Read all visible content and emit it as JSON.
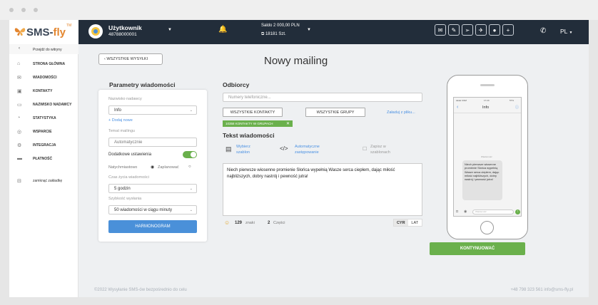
{
  "brand": {
    "logo_sms": "SMS-",
    "logo_fly": "fly",
    "logo_tm": "TM"
  },
  "topbar": {
    "user_name": "Użytkownik",
    "user_id": "48788000001",
    "balance": "Saldo 2 000,00 PLN",
    "sms_count": "18181 Szt.",
    "language": "PL",
    "plus_label": "+"
  },
  "sidebar": {
    "back_to_site": "Przejdź do witryny",
    "items": [
      {
        "label": "STRONA GŁÓWNA",
        "icon": "home-icon"
      },
      {
        "label": "WIADOMOŚCI",
        "icon": "envelope-icon"
      },
      {
        "label": "KONTAKTY",
        "icon": "contacts-icon"
      },
      {
        "label": "NAZWISKO NADAWCY",
        "icon": "sender-icon"
      },
      {
        "label": "STATYSTYKA",
        "icon": "chart-icon"
      },
      {
        "label": "WSPARCIE",
        "icon": "support-icon"
      },
      {
        "label": "INTEGRACJA",
        "icon": "integration-icon"
      },
      {
        "label": "PŁATNOŚĆ",
        "icon": "card-icon"
      }
    ],
    "collapse": "zamknąć zakładkę"
  },
  "page": {
    "back_button": "‹  WSZYSTKIE WYSYŁKI",
    "title": "Nowy mailing"
  },
  "params": {
    "title": "Parametry wiadomości",
    "sender_label": "Nazwisko nadawcy",
    "sender_value": "Info",
    "add_new": "+ Dodaj nowe",
    "subject_label": "Temat mailingu",
    "subject_value": "Automatycznie",
    "extra_settings": "Dodatkowe ustawienia",
    "extra_settings_on": true,
    "immediately": "Natychmiastowo",
    "schedule": "Zaplanować",
    "lifetime_label": "Czas życia wiadomości",
    "lifetime_value": "5 godzin",
    "speed_label": "Szybkość wysłania",
    "speed_value": "50 wiadomości w ciągu minuty",
    "schedule_button": "HARMONOGRAM"
  },
  "recipients": {
    "title": "Odbiorcy",
    "phone_placeholder": "Numery telefoniczne...",
    "all_contacts": "WSZYSTKIE KONTAKTY",
    "all_groups": "WSZYSTKIE GRUPY",
    "upload": "Załaduj z pliku...",
    "tag": "10358 KONTAKTY W GRUPACH"
  },
  "message": {
    "title": "Tekst wiadomości",
    "choose_template": "Wybierz\nszablon",
    "auto_replace": "Automatyczne\nzastępowanie",
    "save_template": "Zapisz w\nszablonach",
    "text": "Niech pierwsze wiosenne promienie Słońca wypełnią Wasze serca ciepłem, dając miłość najbliższych, dobry nastrój i pewność jutra!",
    "chars": "129",
    "chars_label": "znaki",
    "parts": "2",
    "parts_label": "Części",
    "cyr": "CYR",
    "lat": "LAT"
  },
  "preview": {
    "status_left": "●●●● GSM",
    "status_time": "17:20",
    "status_right": "57%",
    "contact": "Info",
    "msg_time": "Wiadomość",
    "bubble": "Niech pierwsze wiosenne promienie Słońca wypełnią Wasze serca ciepłem, dając miłość najbliższych, dobry nastrój i pewność jutra!",
    "input_placeholder": "Wiadomość"
  },
  "continue_button": "KONTYNUOWAĆ",
  "footer": {
    "left": "©2022 Wysyłanie SMS-ów bezpośrednio do celu",
    "right": "+48 798 323 561 info@sms-fly.pl"
  },
  "colors": {
    "topbar": "#222d3a",
    "accent_green": "#6ab04c",
    "accent_blue": "#4a90d9",
    "brand_orange": "#e3862f"
  }
}
